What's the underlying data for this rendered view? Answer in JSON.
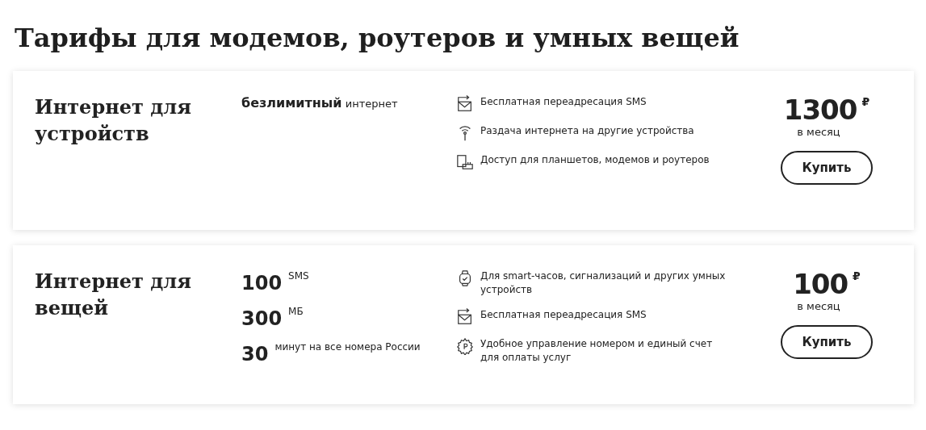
{
  "title": "Тарифы для модемов, роутеров и умных вещей",
  "tariffs": [
    {
      "name": "Интернет для устройств",
      "allowances": [
        {
          "kind": "text",
          "text": "**безлимитный** интернет"
        }
      ],
      "features": [
        {
          "kind": "sms",
          "text": "Бесплатная переадресация SMS"
        },
        {
          "kind": "antenna",
          "text": "Раздача интернета на другие устройства"
        },
        {
          "kind": "devices",
          "text": "Доступ для планшетов, модемов и роутеров"
        }
      ],
      "price": "1300",
      "currency": "₽",
      "period": "в месяц",
      "button": "Купить"
    },
    {
      "name": "Интернет для вещей",
      "allowances": [
        {
          "kind": "quantity",
          "amount": "100",
          "unit": "SMS"
        },
        {
          "kind": "quantity",
          "amount": "300",
          "unit": "МБ"
        },
        {
          "kind": "quantity",
          "amount": "30",
          "unit": "минут на все номера России"
        }
      ],
      "features": [
        {
          "kind": "watch",
          "text": "Для smart-часов, сигнализаций и других умных устройств"
        },
        {
          "kind": "sms",
          "text": "Бесплатная переадресация SMS"
        },
        {
          "kind": "gear",
          "text": "Удобное управление номером и единый счет для оплаты услуг"
        }
      ],
      "price": "100",
      "currency": "₽",
      "period": "в месяц",
      "button": "Купить"
    }
  ]
}
